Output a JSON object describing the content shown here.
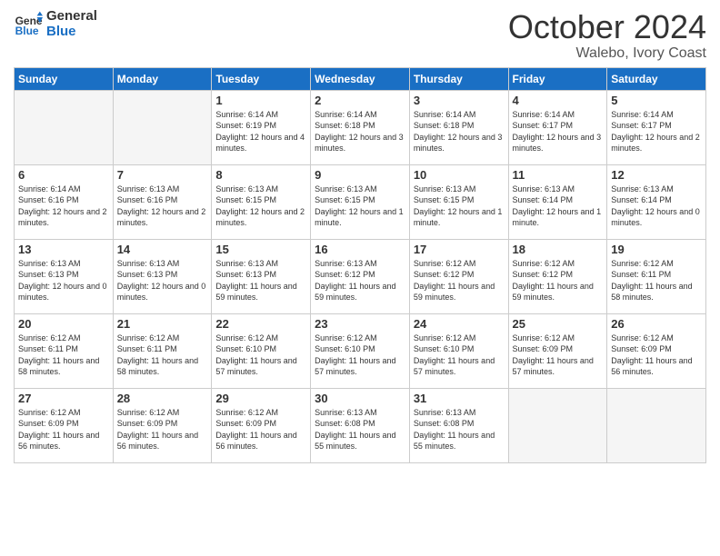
{
  "header": {
    "logo_line1": "General",
    "logo_line2": "Blue",
    "month": "October 2024",
    "location": "Walebo, Ivory Coast"
  },
  "days_of_week": [
    "Sunday",
    "Monday",
    "Tuesday",
    "Wednesday",
    "Thursday",
    "Friday",
    "Saturday"
  ],
  "weeks": [
    [
      {
        "day": "",
        "empty": true
      },
      {
        "day": "",
        "empty": true
      },
      {
        "day": "1",
        "sunrise": "6:14 AM",
        "sunset": "6:19 PM",
        "daylight": "12 hours and 4 minutes."
      },
      {
        "day": "2",
        "sunrise": "6:14 AM",
        "sunset": "6:18 PM",
        "daylight": "12 hours and 3 minutes."
      },
      {
        "day": "3",
        "sunrise": "6:14 AM",
        "sunset": "6:18 PM",
        "daylight": "12 hours and 3 minutes."
      },
      {
        "day": "4",
        "sunrise": "6:14 AM",
        "sunset": "6:17 PM",
        "daylight": "12 hours and 3 minutes."
      },
      {
        "day": "5",
        "sunrise": "6:14 AM",
        "sunset": "6:17 PM",
        "daylight": "12 hours and 2 minutes."
      }
    ],
    [
      {
        "day": "6",
        "sunrise": "6:14 AM",
        "sunset": "6:16 PM",
        "daylight": "12 hours and 2 minutes."
      },
      {
        "day": "7",
        "sunrise": "6:13 AM",
        "sunset": "6:16 PM",
        "daylight": "12 hours and 2 minutes."
      },
      {
        "day": "8",
        "sunrise": "6:13 AM",
        "sunset": "6:15 PM",
        "daylight": "12 hours and 2 minutes."
      },
      {
        "day": "9",
        "sunrise": "6:13 AM",
        "sunset": "6:15 PM",
        "daylight": "12 hours and 1 minute."
      },
      {
        "day": "10",
        "sunrise": "6:13 AM",
        "sunset": "6:15 PM",
        "daylight": "12 hours and 1 minute."
      },
      {
        "day": "11",
        "sunrise": "6:13 AM",
        "sunset": "6:14 PM",
        "daylight": "12 hours and 1 minute."
      },
      {
        "day": "12",
        "sunrise": "6:13 AM",
        "sunset": "6:14 PM",
        "daylight": "12 hours and 0 minutes."
      }
    ],
    [
      {
        "day": "13",
        "sunrise": "6:13 AM",
        "sunset": "6:13 PM",
        "daylight": "12 hours and 0 minutes."
      },
      {
        "day": "14",
        "sunrise": "6:13 AM",
        "sunset": "6:13 PM",
        "daylight": "12 hours and 0 minutes."
      },
      {
        "day": "15",
        "sunrise": "6:13 AM",
        "sunset": "6:13 PM",
        "daylight": "11 hours and 59 minutes."
      },
      {
        "day": "16",
        "sunrise": "6:13 AM",
        "sunset": "6:12 PM",
        "daylight": "11 hours and 59 minutes."
      },
      {
        "day": "17",
        "sunrise": "6:12 AM",
        "sunset": "6:12 PM",
        "daylight": "11 hours and 59 minutes."
      },
      {
        "day": "18",
        "sunrise": "6:12 AM",
        "sunset": "6:12 PM",
        "daylight": "11 hours and 59 minutes."
      },
      {
        "day": "19",
        "sunrise": "6:12 AM",
        "sunset": "6:11 PM",
        "daylight": "11 hours and 58 minutes."
      }
    ],
    [
      {
        "day": "20",
        "sunrise": "6:12 AM",
        "sunset": "6:11 PM",
        "daylight": "11 hours and 58 minutes."
      },
      {
        "day": "21",
        "sunrise": "6:12 AM",
        "sunset": "6:11 PM",
        "daylight": "11 hours and 58 minutes."
      },
      {
        "day": "22",
        "sunrise": "6:12 AM",
        "sunset": "6:10 PM",
        "daylight": "11 hours and 57 minutes."
      },
      {
        "day": "23",
        "sunrise": "6:12 AM",
        "sunset": "6:10 PM",
        "daylight": "11 hours and 57 minutes."
      },
      {
        "day": "24",
        "sunrise": "6:12 AM",
        "sunset": "6:10 PM",
        "daylight": "11 hours and 57 minutes."
      },
      {
        "day": "25",
        "sunrise": "6:12 AM",
        "sunset": "6:09 PM",
        "daylight": "11 hours and 57 minutes."
      },
      {
        "day": "26",
        "sunrise": "6:12 AM",
        "sunset": "6:09 PM",
        "daylight": "11 hours and 56 minutes."
      }
    ],
    [
      {
        "day": "27",
        "sunrise": "6:12 AM",
        "sunset": "6:09 PM",
        "daylight": "11 hours and 56 minutes."
      },
      {
        "day": "28",
        "sunrise": "6:12 AM",
        "sunset": "6:09 PM",
        "daylight": "11 hours and 56 minutes."
      },
      {
        "day": "29",
        "sunrise": "6:12 AM",
        "sunset": "6:09 PM",
        "daylight": "11 hours and 56 minutes."
      },
      {
        "day": "30",
        "sunrise": "6:13 AM",
        "sunset": "6:08 PM",
        "daylight": "11 hours and 55 minutes."
      },
      {
        "day": "31",
        "sunrise": "6:13 AM",
        "sunset": "6:08 PM",
        "daylight": "11 hours and 55 minutes."
      },
      {
        "day": "",
        "empty": true
      },
      {
        "day": "",
        "empty": true
      }
    ]
  ]
}
